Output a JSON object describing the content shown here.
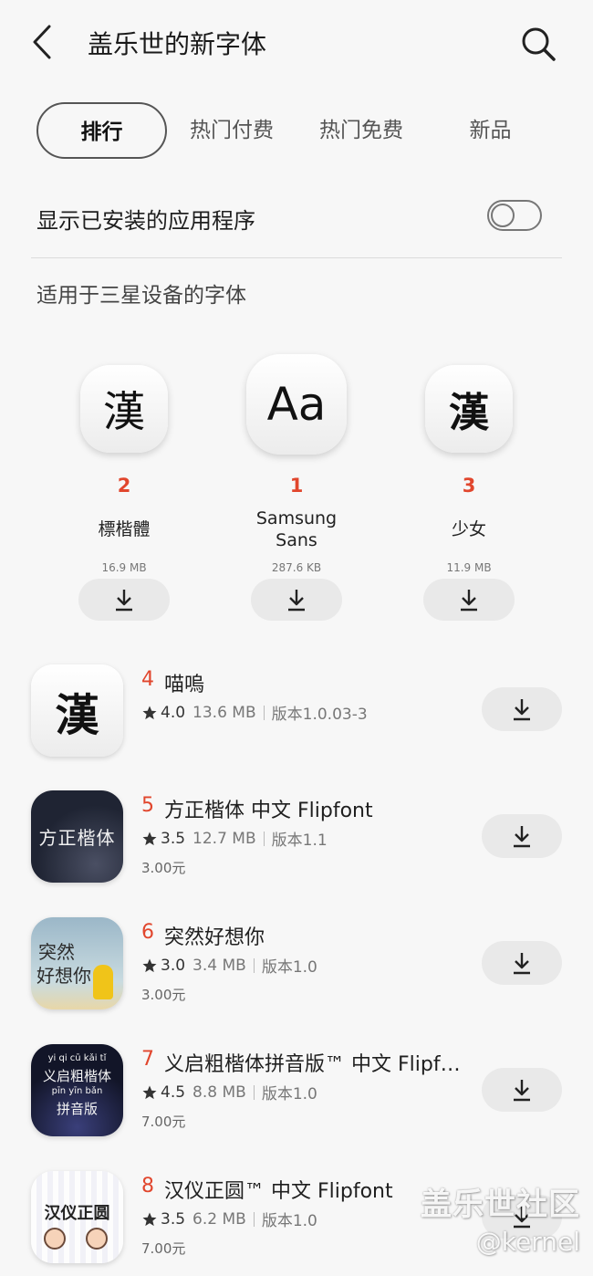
{
  "header": {
    "title": "盖乐世的新字体",
    "back_icon": "back-arrow-icon",
    "search_icon": "search-icon"
  },
  "tabs": [
    {
      "label": "排行",
      "active": true
    },
    {
      "label": "热门付费",
      "active": false
    },
    {
      "label": "热门免费",
      "active": false
    },
    {
      "label": "新品",
      "active": false
    }
  ],
  "show_installed": {
    "label": "显示已安装的应用程序",
    "on": false
  },
  "section": {
    "title": "适用于三星设备的字体"
  },
  "top_fonts": [
    {
      "rank": "2",
      "name": "標楷體",
      "size": "16.9 MB",
      "icon_text": "漢"
    },
    {
      "rank": "1",
      "name": "Samsung Sans",
      "size": "287.6 KB",
      "icon_text": "Aa"
    },
    {
      "rank": "3",
      "name": "少女",
      "size": "11.9 MB",
      "icon_text": "漢"
    }
  ],
  "list": [
    {
      "rank": "4",
      "name": "喵嗚",
      "rating": "4.0",
      "size": "13.6 MB",
      "version": "版本1.0.03-3",
      "price": "",
      "icon_text": "漢"
    },
    {
      "rank": "5",
      "name": "方正楷体 中文 Flipfont",
      "rating": "3.5",
      "size": "12.7 MB",
      "version": "版本1.1",
      "price": "3.00元",
      "icon_text": "方正楷体"
    },
    {
      "rank": "6",
      "name": "突然好想你",
      "rating": "3.0",
      "size": "3.4 MB",
      "version": "版本1.0",
      "price": "3.00元",
      "icon_text_1": "突然",
      "icon_text_2": "好想你"
    },
    {
      "rank": "7",
      "name": "义启粗楷体拼音版™ 中文 Flipfo...",
      "rating": "4.5",
      "size": "8.8 MB",
      "version": "版本1.0",
      "price": "7.00元",
      "icon_pinyin": "yi  qi  cū  kǎi  tǐ",
      "icon_text_1": "义启粗楷体",
      "icon_pinyin_2": "pīn  yīn  bǎn",
      "icon_text_2": "拼音版"
    },
    {
      "rank": "8",
      "name": "汉仪正圆™ 中文 Flipfont",
      "rating": "3.5",
      "size": "6.2 MB",
      "version": "版本1.0",
      "price": "7.00元",
      "icon_text": "汉仪正圆"
    }
  ],
  "watermark": {
    "line1": "盖乐世社区",
    "line2": "@kernel"
  },
  "colors": {
    "accent_rank": "#e1462d",
    "background": "#f7f7f7",
    "button_bg": "#e9e9e9"
  },
  "icons": {
    "download": "download-icon",
    "star": "star-icon"
  }
}
